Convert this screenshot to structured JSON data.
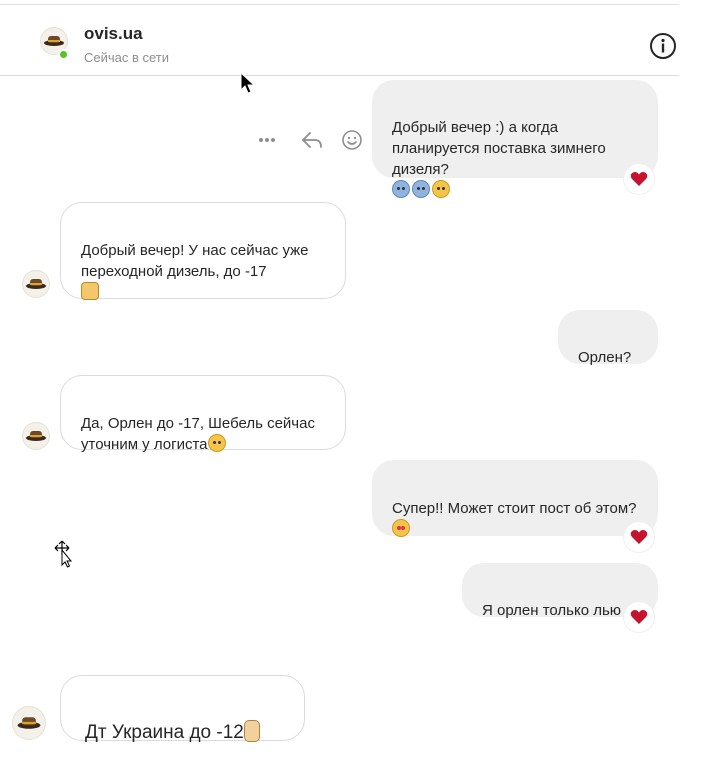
{
  "header": {
    "contact_name": "ovis.ua",
    "status": "Сейчас в сети",
    "icons": {
      "avatar": "hat-avatar",
      "info": "info-circle-icon"
    },
    "colors": {
      "online": "#58c322"
    }
  },
  "message_actions": {
    "icons": [
      "more-horizontal-icon",
      "reply-icon",
      "emoji-reaction-icon"
    ]
  },
  "messages": [
    {
      "direction": "out",
      "text": "Добрый вечер :) а когда планируется поставка зимнего дизеля?",
      "emoji": [
        "cold-face",
        "cold-face",
        "grinning-face"
      ],
      "reaction": "heart"
    },
    {
      "direction": "in",
      "text": "Добрый вечер! У нас сейчас уже переходной дизель, до -17",
      "emoji": [
        "raising-hands"
      ]
    },
    {
      "direction": "out",
      "text": "Орлен?"
    },
    {
      "direction": "in",
      "text": "Да, Орлен до -17, Шебель сейчас уточним у логиста",
      "emoji": [
        "smiling-face"
      ]
    },
    {
      "direction": "out",
      "text": "Супер!! Может стоит пост об этом?",
      "emoji": [
        "star-struck"
      ],
      "reaction": "heart"
    },
    {
      "direction": "out",
      "text": "Я орлен только лью",
      "reaction": "heart"
    },
    {
      "direction": "in",
      "text": "Дт Украина до -12",
      "emoji": [
        "victory-hand"
      ]
    }
  ],
  "colors": {
    "outgoing_bubble": "#efefef",
    "incoming_border": "#dbdbdb",
    "heart": "#ed4956"
  }
}
